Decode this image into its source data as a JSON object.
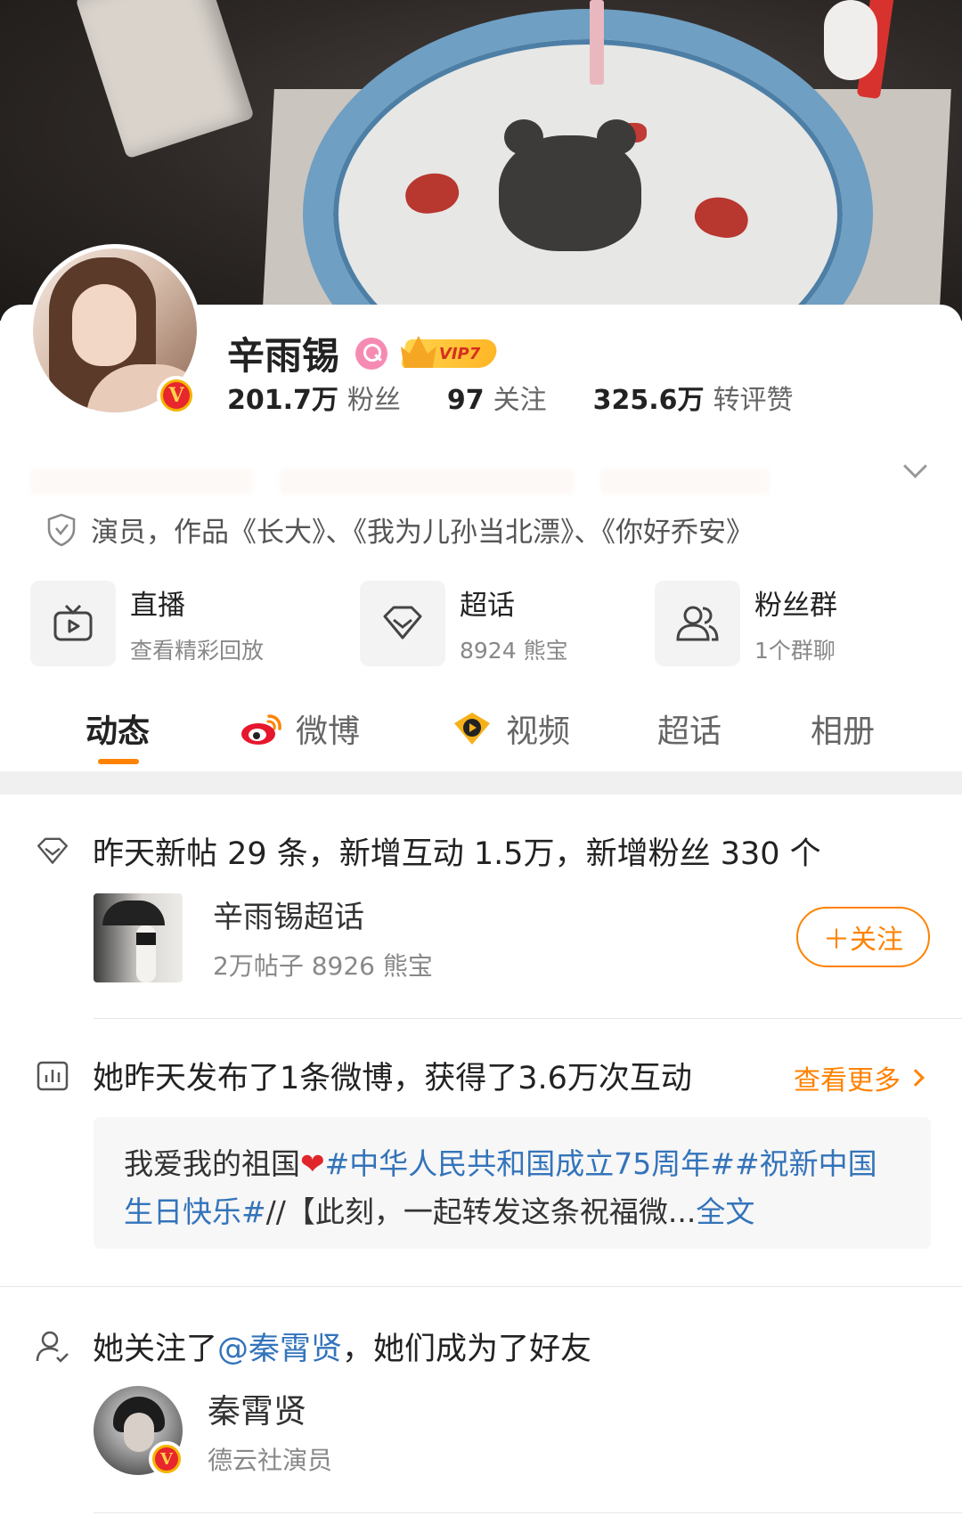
{
  "profile": {
    "name": "辛雨锡",
    "vip_label": "VIP7",
    "stats": [
      {
        "value": "201.7万",
        "label": "粉丝"
      },
      {
        "value": "97",
        "label": "关注"
      },
      {
        "value": "325.6万",
        "label": "转评赞"
      }
    ],
    "bio": "演员，作品《长大》、《我为儿孙当北漂》、《你好乔安》"
  },
  "quick_links": [
    {
      "title": "直播",
      "subtitle": "查看精彩回放",
      "icon": "tv-icon"
    },
    {
      "title": "超话",
      "subtitle": "8924 熊宝",
      "icon": "diamond-icon"
    },
    {
      "title": "粉丝群",
      "subtitle": "1个群聊",
      "icon": "group-icon"
    }
  ],
  "tabs": [
    {
      "label": "动态",
      "active": true
    },
    {
      "label": "微博",
      "icon": "weibo-icon"
    },
    {
      "label": "视频",
      "icon": "video-icon"
    },
    {
      "label": "超话"
    },
    {
      "label": "相册"
    }
  ],
  "feed": {
    "supertopic_summary": "昨天新帖 29 条，新增互动 1.5万，新增粉丝 330 个",
    "supertopic": {
      "name": "辛雨锡超话",
      "meta": "2万帖子 8926 熊宝",
      "follow_label": "＋关注"
    },
    "post_summary": "她昨天发布了1条微博，获得了3.6万次互动",
    "see_more": "查看更多",
    "post": {
      "text_a": "我爱我的祖国",
      "emoji": "❤",
      "tag_a": "#中华人民共和国成立75周年#",
      "tag_b": "#祝新中国生日快乐#",
      "text_b": "//【此刻，一起转发这条祝福微...",
      "more": "全文"
    },
    "follow_prefix": "她关注了",
    "follow_mention": "@秦霄贤",
    "follow_suffix": "，她们成为了好友",
    "friend": {
      "name": "秦霄贤",
      "desc": "德云社演员"
    }
  },
  "colors": {
    "accent": "#ff8200",
    "link": "#3474ba",
    "verified": "#e8262d",
    "vip_gold": "#ffb626"
  }
}
